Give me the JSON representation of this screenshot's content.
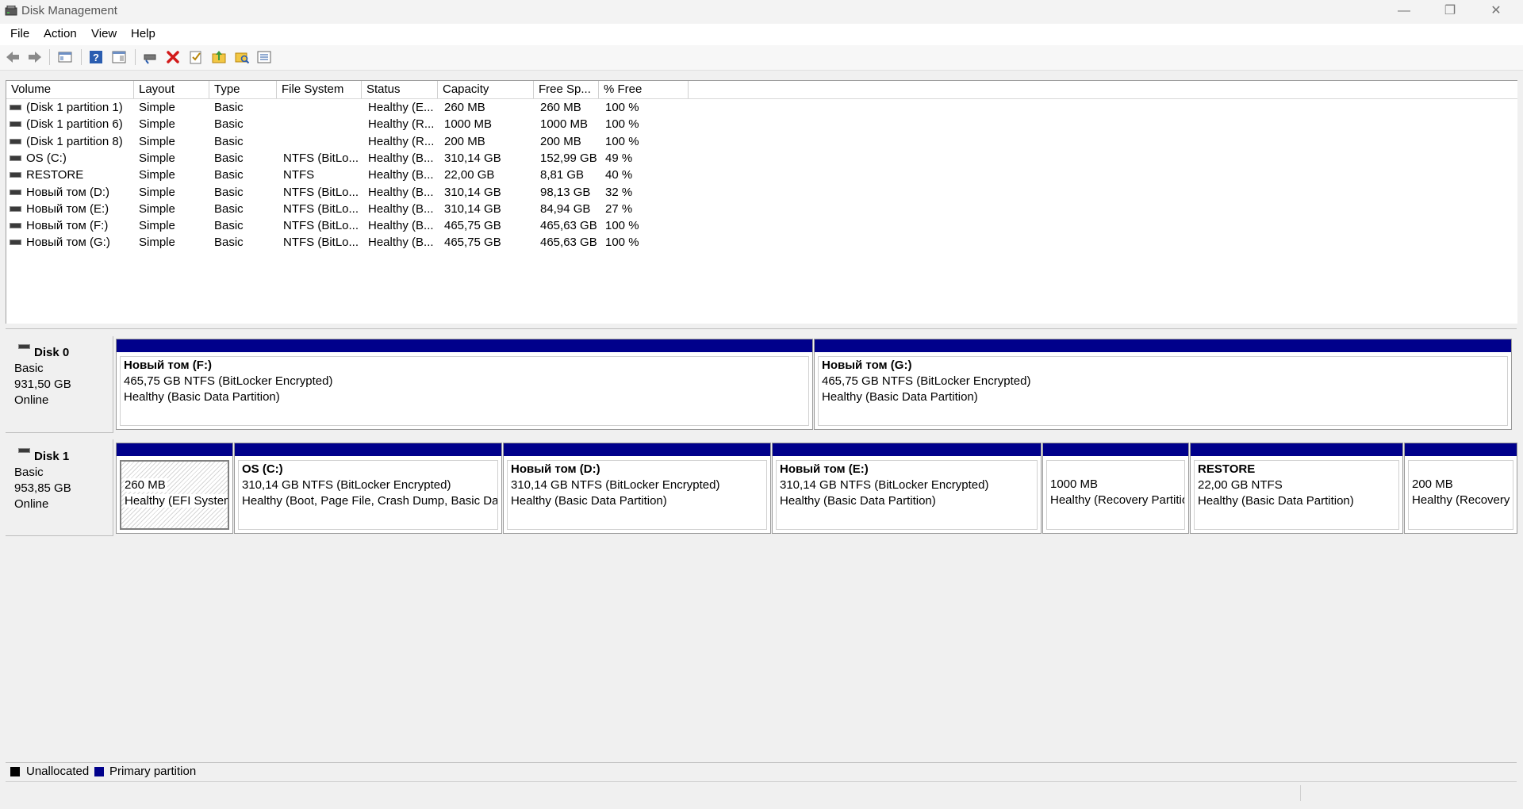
{
  "window": {
    "title": "Disk Management",
    "controls": {
      "minimize": "—",
      "maximize": "❐",
      "close": "✕"
    }
  },
  "menu": [
    "File",
    "Action",
    "View",
    "Help"
  ],
  "toolbar": {
    "icons": [
      "back-icon",
      "forward-icon",
      "console-tree-icon",
      "help-icon",
      "properties-pane-icon",
      "connect-disk-icon",
      "delete-icon",
      "check-icon",
      "folder-up-icon",
      "folder-search-icon",
      "list-view-icon"
    ]
  },
  "volume_list": {
    "columns": [
      "Volume",
      "Layout",
      "Type",
      "File System",
      "Status",
      "Capacity",
      "Free Sp...",
      "% Free"
    ],
    "rows": [
      [
        "(Disk 1 partition 1)",
        "Simple",
        "Basic",
        "",
        "Healthy (E...",
        "260 MB",
        "260 MB",
        "100 %"
      ],
      [
        "(Disk 1 partition 6)",
        "Simple",
        "Basic",
        "",
        "Healthy (R...",
        "1000 MB",
        "1000 MB",
        "100 %"
      ],
      [
        "(Disk 1 partition 8)",
        "Simple",
        "Basic",
        "",
        "Healthy (R...",
        "200 MB",
        "200 MB",
        "100 %"
      ],
      [
        "OS (C:)",
        "Simple",
        "Basic",
        "NTFS (BitLo...",
        "Healthy (B...",
        "310,14 GB",
        "152,99 GB",
        "49 %"
      ],
      [
        "RESTORE",
        "Simple",
        "Basic",
        "NTFS",
        "Healthy (B...",
        "22,00 GB",
        "8,81 GB",
        "40 %"
      ],
      [
        "Новый том (D:)",
        "Simple",
        "Basic",
        "NTFS (BitLo...",
        "Healthy (B...",
        "310,14 GB",
        "98,13 GB",
        "32 %"
      ],
      [
        "Новый том (E:)",
        "Simple",
        "Basic",
        "NTFS (BitLo...",
        "Healthy (B...",
        "310,14 GB",
        "84,94 GB",
        "27 %"
      ],
      [
        "Новый том (F:)",
        "Simple",
        "Basic",
        "NTFS (BitLo...",
        "Healthy (B...",
        "465,75 GB",
        "465,63 GB",
        "100 %"
      ],
      [
        "Новый том (G:)",
        "Simple",
        "Basic",
        "NTFS (BitLo...",
        "Healthy (B...",
        "465,75 GB",
        "465,63 GB",
        "100 %"
      ]
    ]
  },
  "disks": [
    {
      "name": "Disk 0",
      "type": "Basic",
      "size": "931,50 GB",
      "status": "Online",
      "partitions": [
        {
          "title": "Новый том  (F:)",
          "line1": "465,75 GB NTFS (BitLocker Encrypted)",
          "line2": "Healthy (Basic Data Partition)"
        },
        {
          "title": "Новый том  (G:)",
          "line1": "465,75 GB NTFS (BitLocker Encrypted)",
          "line2": "Healthy (Basic Data Partition)"
        }
      ]
    },
    {
      "name": "Disk 1",
      "type": "Basic",
      "size": "953,85 GB",
      "status": "Online",
      "partitions": [
        {
          "title": "",
          "line1": "260 MB",
          "line2": "Healthy (EFI System"
        },
        {
          "title": "OS  (C:)",
          "line1": "310,14 GB NTFS (BitLocker Encrypted)",
          "line2": "Healthy (Boot, Page File, Crash Dump, Basic Data"
        },
        {
          "title": "Новый том  (D:)",
          "line1": "310,14 GB NTFS (BitLocker Encrypted)",
          "line2": "Healthy (Basic Data Partition)"
        },
        {
          "title": "Новый том  (E:)",
          "line1": "310,14 GB NTFS (BitLocker Encrypted)",
          "line2": "Healthy (Basic Data Partition)"
        },
        {
          "title": "",
          "line1": "1000 MB",
          "line2": "Healthy (Recovery Partitio"
        },
        {
          "title": "RESTORE",
          "line1": "22,00 GB NTFS",
          "line2": "Healthy (Basic Data Partition)"
        },
        {
          "title": "",
          "line1": "200 MB",
          "line2": "Healthy (Recovery"
        }
      ]
    }
  ],
  "legend": [
    {
      "label": "Unallocated",
      "color": "#000000"
    },
    {
      "label": "Primary partition",
      "color": "#00008b"
    }
  ]
}
